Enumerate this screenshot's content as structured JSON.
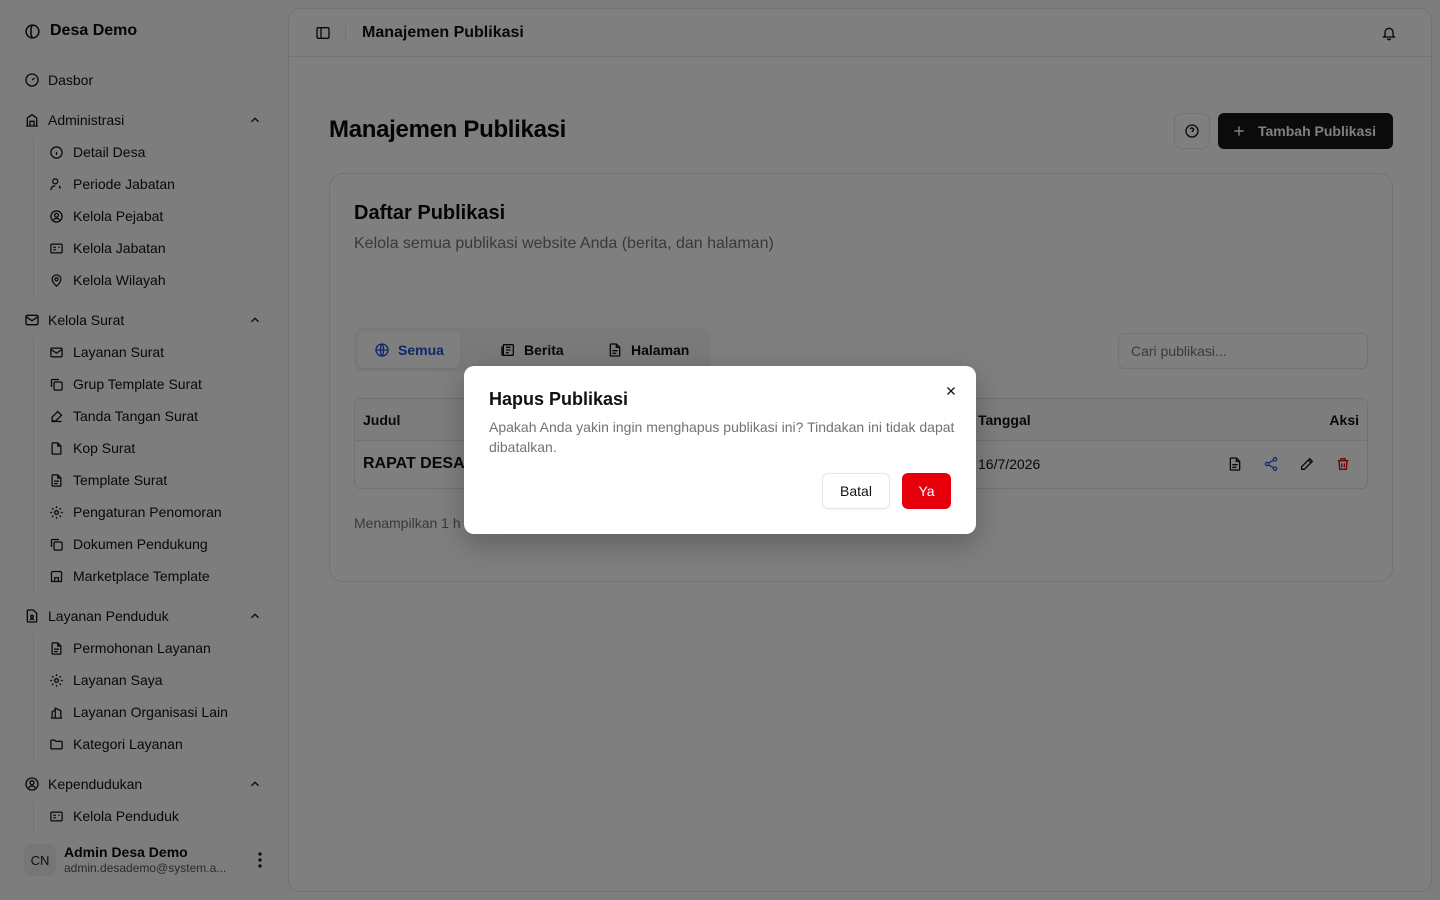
{
  "app": {
    "name": "Desa Demo"
  },
  "sidebar": {
    "dashboard": "Dasbor",
    "groups": {
      "administrasi": {
        "label": "Administrasi",
        "items": [
          "Detail Desa",
          "Periode Jabatan",
          "Kelola Pejabat",
          "Kelola Jabatan",
          "Kelola Wilayah"
        ]
      },
      "surat": {
        "label": "Kelola Surat",
        "items": [
          "Layanan Surat",
          "Grup Template Surat",
          "Tanda Tangan Surat",
          "Kop Surat",
          "Template Surat",
          "Pengaturan Penomoran",
          "Dokumen Pendukung",
          "Marketplace Template"
        ]
      },
      "penduduk_layanan": {
        "label": "Layanan Penduduk",
        "items": [
          "Permohonan Layanan",
          "Layanan Saya",
          "Layanan Organisasi Lain",
          "Kategori Layanan"
        ]
      },
      "kependudukan": {
        "label": "Kependudukan",
        "items": [
          "Kelola Penduduk"
        ]
      }
    },
    "user": {
      "initials": "CN",
      "name": "Admin Desa Demo",
      "email": "admin.desademo@system.a..."
    }
  },
  "topbar": {
    "title": "Manajemen Publikasi"
  },
  "page": {
    "title": "Manajemen Publikasi",
    "add_button": "Tambah Publikasi"
  },
  "card": {
    "title": "Daftar Publikasi",
    "description": "Kelola semua publikasi website Anda (berita, dan halaman)",
    "tabs": [
      "Semua",
      "Berita",
      "Halaman"
    ],
    "active_tab": "Semua",
    "search_placeholder": "Cari publikasi...",
    "columns": {
      "judul": "Judul",
      "tanggal": "Tanggal",
      "aksi": "Aksi"
    },
    "rows": [
      {
        "judul": "RAPAT DESA",
        "tanggal": "16/7/2026"
      }
    ],
    "footer": "Menampilkan 1 h"
  },
  "dialog": {
    "title": "Hapus Publikasi",
    "description": "Apakah Anda yakin ingin menghapus publikasi ini? Tindakan ini tidak dapat dibatalkan.",
    "cancel": "Batal",
    "confirm": "Ya"
  },
  "colors": {
    "primary_dark": "#171717",
    "active_tab": "#1d4ed8",
    "danger": "#e7000b",
    "share_icon": "#2563eb"
  }
}
